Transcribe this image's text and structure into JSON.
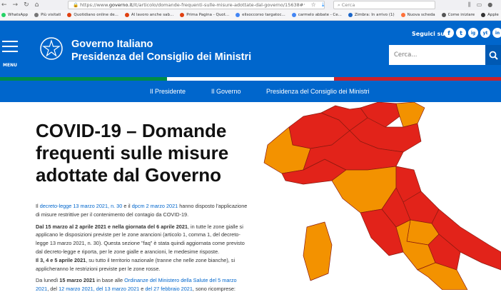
{
  "browser": {
    "url_prefix": "https://www.",
    "url_domain": "governo.it",
    "url_rest": "/it/articolo/domande-frequenti-sulle-misure-adottate-dal-governo/15638#",
    "search_placeholder": "Cerca",
    "bookmarks": [
      {
        "label": "WhatsApp",
        "color": "#25d366"
      },
      {
        "label": "Più visitati",
        "color": "#777777"
      },
      {
        "label": "Quotidiano online de...",
        "color": "#e04010"
      },
      {
        "label": "Al lavoro anche sab...",
        "color": "#e04010"
      },
      {
        "label": "Prima Pagina - Quot...",
        "color": "#e04010"
      },
      {
        "label": "elisoccorso targatoc...",
        "color": "#4285f4"
      },
      {
        "label": "carmelo abbate - Ce...",
        "color": "#4285f4"
      },
      {
        "label": "Zimbra: In arrivo (1)",
        "color": "#1a66c8"
      },
      {
        "label": "Nuova scheda",
        "color": "#ff7139"
      },
      {
        "label": "Come iniziare",
        "color": "#555555"
      },
      {
        "label": "Apple",
        "color": "#333333"
      },
      {
        "label": "(1) WhatsApp",
        "color": "#25d366"
      },
      {
        "label": "WhatsApp",
        "color": "#25d366"
      },
      {
        "label": "WhatsApp",
        "color": "#25d366"
      }
    ]
  },
  "header": {
    "menu_label": "MENU",
    "title_line1": "Governo Italiano",
    "title_line2": "Presidenza del Consiglio dei Ministri",
    "follow_label": "Seguici su:",
    "social": [
      "f",
      "t",
      "ig",
      "yt",
      "in"
    ],
    "search_placeholder": "Cerca...",
    "brand_color": "#0066cc"
  },
  "nav": [
    "Il Presidente",
    "Il Governo",
    "Presidenza del Consiglio dei Ministri"
  ],
  "article": {
    "title": "COVID-19 – Domande frequenti sulle misure adottate dal Governo",
    "p1": {
      "t1": "Il ",
      "link1": "decreto-legge 13 marzo 2021, n. 30",
      "t2": " e il ",
      "link2": "dpcm 2 marzo 2021",
      "t3": " hanno disposto l'applicazione di misure restrittive per il contenimento del contagio da COVID-19."
    },
    "p2": {
      "b1": "Dal 15 marzo al 2 aprile 2021 e nella giornata del 6 aprile 2021",
      "t1": ", in tutte le zone gialle si applicano le disposizioni previste per le zone arancioni (articolo 1, comma 1, del decreto-legge 13 marzo 2021, n. 30). Questa sezione \"faq\" è stata quindi aggiornata come previsto dal decreto-legge e riporta, per le zone gialle e arancioni, le medesime risposte.",
      "b2": "Il 3, 4 e 5 aprile 2021",
      "t2": ", su tutto il territorio nazionale (tranne che nelle zone bianche), si applicheranno le restrizioni previste per le zone rosse."
    },
    "p3": {
      "t1": "Da lunedì ",
      "b1": "15 marzo 2021",
      "t2": " in base alle ",
      "link1": "Ordinanze del Ministero della Salute del 5 marzo 2021",
      "t3": ", del ",
      "link2": "12 marzo 2021, del 13 marzo 2021",
      "t4": " e ",
      "link3": "del 27 febbraio 2021",
      "t5": ", sono ricomprese:"
    }
  },
  "map_colors": {
    "red": "#e2231a",
    "orange": "#f39200"
  }
}
